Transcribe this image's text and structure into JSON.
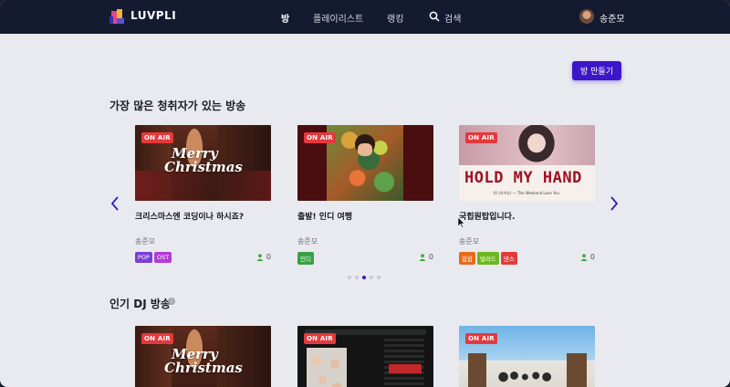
{
  "nav": {
    "logo_text": "LUVPLI",
    "links": [
      "방",
      "플레이리스트",
      "랭킹"
    ],
    "search_label": "검색",
    "user_name": "송준모"
  },
  "create_button": "방 만들기",
  "sections": {
    "popular": "가장 많은 청취자가 있는 방송",
    "dj": "인기 DJ 방송"
  },
  "badge": "ON AIR",
  "cards": [
    {
      "title": "크리스마스엔 코딩이나 하시죠?",
      "owner": "송준모",
      "tags": [
        {
          "label": "POP",
          "color": "#7a3fd6"
        },
        {
          "label": "OST",
          "color": "#b43ad6"
        }
      ],
      "listeners": "0",
      "thumb_text": "Merry Christmas"
    },
    {
      "title": "출발! 인디 여행",
      "owner": "송준모",
      "tags": [
        {
          "label": "인디",
          "color": "#3aa142"
        }
      ],
      "listeners": "0"
    },
    {
      "title": "국힙원탑입니다.",
      "owner": "송준모",
      "tags": [
        {
          "label": "힙합",
          "color": "#e66a1c"
        },
        {
          "label": "발라드",
          "color": "#6bb81c"
        },
        {
          "label": "댄스",
          "color": "#e23a3a"
        }
      ],
      "listeners": "0",
      "thumb_text": "HOLD MY HAND",
      "thumb_sub": "IU (아이유) — The Weekend Love You"
    }
  ],
  "dj_cards": [
    {
      "thumb_text": "Merry Christmas"
    },
    {},
    {}
  ],
  "carousel": {
    "count": 5,
    "active": 3
  },
  "colors": {
    "accent": "#3b17c9",
    "nav_bg": "#141a2f",
    "onair": "#e4393c"
  }
}
